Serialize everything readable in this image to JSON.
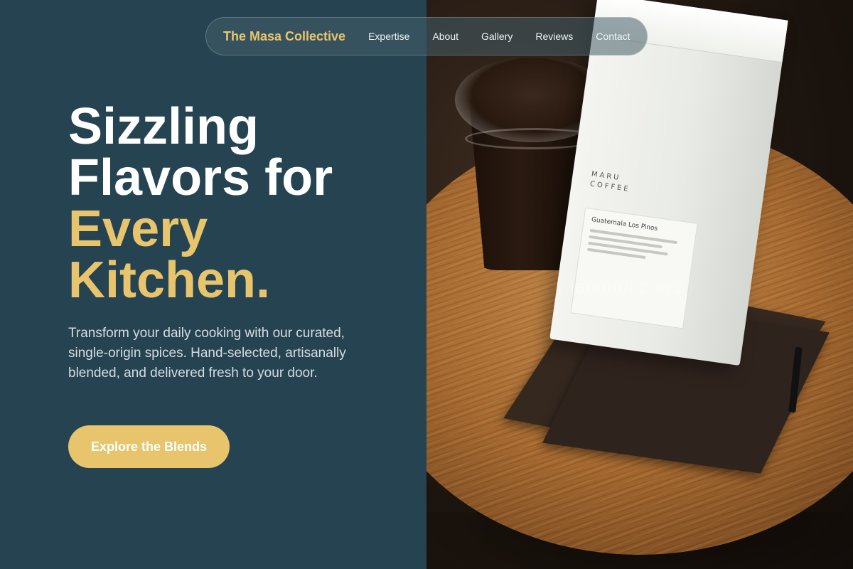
{
  "nav": {
    "brand": "The Masa Collective",
    "links": [
      "Expertise",
      "About",
      "Gallery",
      "Reviews",
      "Contact"
    ]
  },
  "hero": {
    "title_line1": "Sizzling",
    "title_line2": "Flavors for",
    "title_accent1": "Every",
    "title_accent2": "Kitchen.",
    "subtitle": "Transform your daily cooking with our curated, single-origin spices. Hand-selected, artisanally blended, and delivered fresh to your door.",
    "cta_label": "Explore the Blends"
  },
  "photo": {
    "bag_brand": "MARU\nCOFFEE",
    "bag_label_title": "Guatemala Los Pinos",
    "watermark": "laconolic.xyz"
  },
  "colors": {
    "background": "#264352",
    "accent": "#e8c56c",
    "text": "#ffffff"
  }
}
